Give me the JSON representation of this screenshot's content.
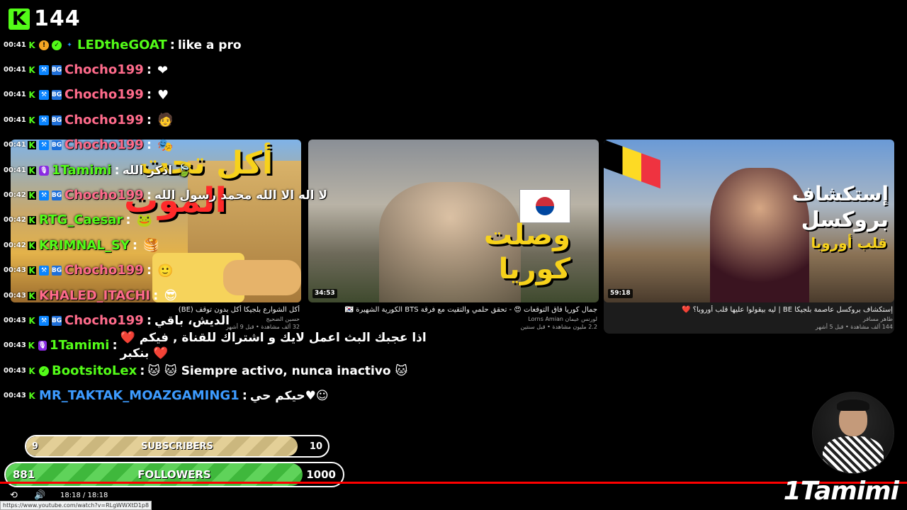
{
  "viewer_count": {
    "logo": "K",
    "count": "144"
  },
  "videos": [
    {
      "duration": "",
      "overlay_line1": "أكل تحت",
      "overlay_line2": "الموت",
      "title": "أكل الشوارع بلجيكا أكل بدون توقف (BE)",
      "channel": "حسين الضحيج",
      "meta": "32 ألف مشاهدة • قبل 9 أشهر"
    },
    {
      "duration": "34:53",
      "overlay_line1": "وصلت",
      "overlay_line2": "كوريا",
      "title": "جمال كوريا فاق التوقعات 😍 - تحقق حلمي والتقيت مع فرقة BTS الكورية الشهيرة 🇰🇷",
      "channel": "لورنس عيمان Lorns Amian",
      "meta": "2.2 مليون مشاهدة • قبل سنتين"
    },
    {
      "duration": "59:18",
      "overlay_line1": "إستكشاف",
      "overlay_line2": "بروكسل",
      "overlay_line3": "قلب أوروبا",
      "title": "إستكشاف بروكسل عاصمة بلجيكا BE | ليه بيقولوا عليها قلب أوروبا؟ ❤️",
      "channel": "طاهر مسافر",
      "meta": "144 ألف مشاهدة • قبل 5 أشهر"
    }
  ],
  "chat": [
    {
      "time": "00:41",
      "badges": [
        "gift-badge",
        "verified-badge",
        "sparkle-badge"
      ],
      "user": "LEDtheGOAT",
      "color": "#53fc18",
      "message": "like a pro",
      "emote": ""
    },
    {
      "time": "00:41",
      "badges": [
        "sword-badge",
        "sub-badge"
      ],
      "user": "Chocho199",
      "color": "#ff6b8b",
      "message": "",
      "emote": "❤"
    },
    {
      "time": "00:41",
      "badges": [
        "sword-badge",
        "sub-badge"
      ],
      "user": "Chocho199",
      "color": "#ff6b8b",
      "message": "",
      "emote": "♥"
    },
    {
      "time": "00:41",
      "badges": [
        "sword-badge",
        "sub-badge"
      ],
      "user": "Chocho199",
      "color": "#ff6b8b",
      "message": "",
      "emote": "🧑"
    },
    {
      "time": "00:41",
      "badges": [
        "sword-badge",
        "sub-badge"
      ],
      "user": "Chocho199",
      "color": "#ff6b8b",
      "message": "",
      "emote": "🎭"
    },
    {
      "time": "00:41",
      "badges": [
        "mic-badge"
      ],
      "user": "1Tamimi",
      "color": "#53fc18",
      "message": "اذكر الله 🍃",
      "emote": ""
    },
    {
      "time": "00:42",
      "badges": [
        "sword-badge",
        "sub-badge"
      ],
      "user": "Chocho199",
      "color": "#ff6b8b",
      "message": "لا اله الا الله محمد رسول الله",
      "emote": ""
    },
    {
      "time": "00:42",
      "badges": [],
      "user": "RTG_Caesar",
      "color": "#53fc18",
      "message": "",
      "emote": "🐸"
    },
    {
      "time": "00:42",
      "badges": [],
      "user": "KRIMNAL_SY",
      "color": "#53fc18",
      "message": "",
      "emote": "🥞"
    },
    {
      "time": "00:43",
      "badges": [
        "sword-badge",
        "sub-badge"
      ],
      "user": "Chocho199",
      "color": "#ff6b8b",
      "message": "",
      "emote": "🙂"
    },
    {
      "time": "00:43",
      "badges": [],
      "user": "KHALED_ITACHI",
      "color": "#ff6b8b",
      "message": "",
      "emote": "😎"
    },
    {
      "time": "00:43",
      "badges": [
        "sword-badge",
        "sub-badge"
      ],
      "user": "Chocho199",
      "color": "#ff6b8b",
      "message": "الديش، باقي",
      "emote": ""
    },
    {
      "time": "00:43",
      "badges": [
        "mic-badge"
      ],
      "user": "1Tamimi",
      "color": "#53fc18",
      "message": "❤️ اذا عجبك البث اعمل لايك و اشتراك للقناة , فيكم بنكبر ❤️",
      "emote": ""
    },
    {
      "time": "00:43",
      "badges": [
        "verified-badge"
      ],
      "user": "BootsitoLex",
      "color": "#53fc18",
      "message": "🐱 🐱 Siempre activo, nunca inactivo 🐱",
      "emote": ""
    },
    {
      "time": "00:43",
      "badges": [],
      "user": "MR_TAKTAK_MOAZGAMING1",
      "color": "#3d9bff",
      "message": "حيكم حي♥☺",
      "emote": ""
    }
  ],
  "goals": {
    "subscribers": {
      "label": "SUBSCRIBERS",
      "current": "9",
      "target": "10",
      "progress": 0.9,
      "color": "#d9c48a"
    },
    "followers": {
      "label": "FOLLOWERS",
      "current": "881",
      "target": "1000",
      "progress": 0.881,
      "color": "#53fc18"
    }
  },
  "player": {
    "time": "18:18 / 18:18",
    "url": "https://www.youtube.com/watch?v=RLgWWXtD1p8",
    "progress": 1.0
  },
  "streamer": {
    "brand": "1Tamimi"
  }
}
